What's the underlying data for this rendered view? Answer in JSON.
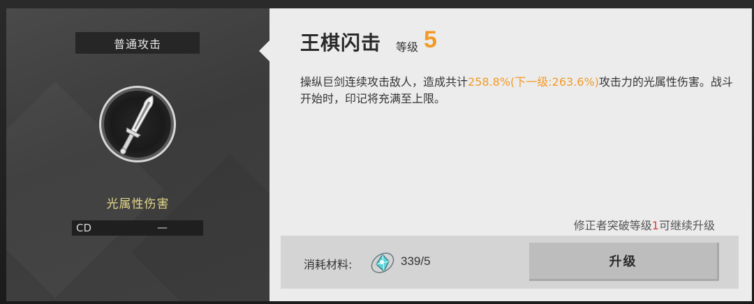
{
  "left_panel": {
    "type_label": "普通攻击",
    "damage_type": "光属性伤害",
    "cd_label": "CD",
    "cd_value": "—"
  },
  "skill": {
    "name": "王棋闪击",
    "level_label": "等级",
    "level_value": "5",
    "description_prefix": "操纵巨剑连续攻击敌人，造成共计",
    "description_highlight": "258.8%(下一级:263.6%)",
    "description_suffix": "攻击力的光属性伤害。战斗开始时，印记将充满至上限。"
  },
  "requirement": {
    "prefix": "修正者突破等级",
    "value": "1",
    "suffix": "可继续升级"
  },
  "materials": {
    "label": "消耗材料:",
    "count": "339/5",
    "icon": "crystal-core-icon"
  },
  "upgrade_button": {
    "label": "升级"
  },
  "colors": {
    "accent": "#f29a26",
    "damage_type": "#e6d88a",
    "requirement_highlight": "#e23b3b"
  }
}
